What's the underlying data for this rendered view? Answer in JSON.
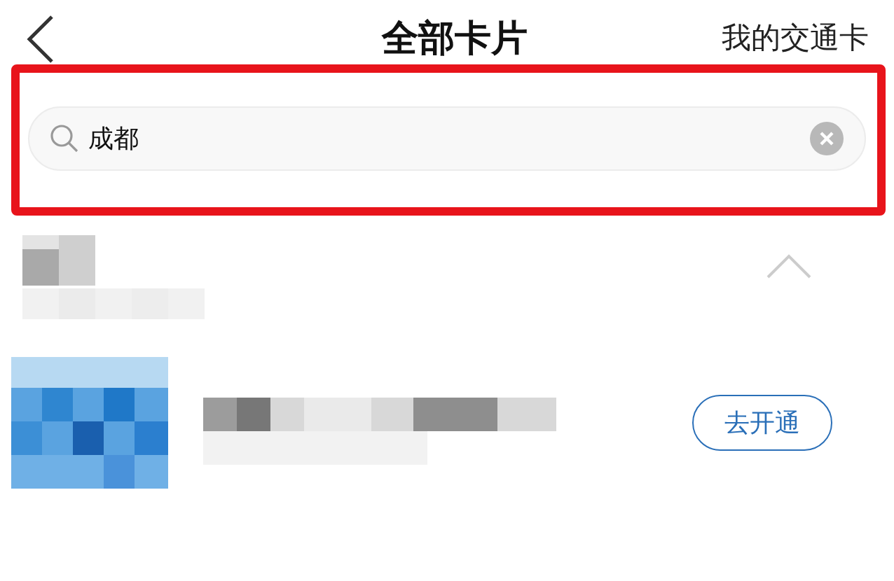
{
  "header": {
    "title": "全部卡片",
    "right_link": "我的交通卡"
  },
  "search": {
    "value": "成都"
  },
  "group": {
    "expanded": true
  },
  "cards": [
    {
      "action": "去开通"
    }
  ]
}
